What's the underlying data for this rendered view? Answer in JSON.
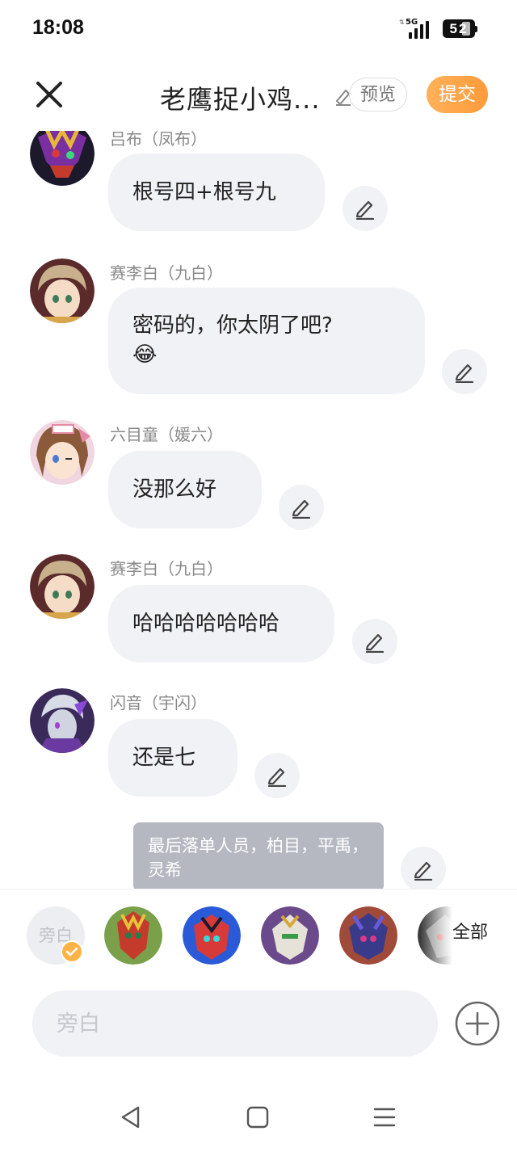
{
  "status_bar": {
    "time": "18:08",
    "network": "5G",
    "battery": "52"
  },
  "header": {
    "title": "老鹰捉小鸡...",
    "preview_label": "预览",
    "submit_label": "提交"
  },
  "messages": [
    {
      "sender": "吕布（凤布）",
      "text": "根号四+根号九",
      "emoji": ""
    },
    {
      "sender": "赛李白（九白）",
      "text": "密码的，你太阴了吧?",
      "emoji": "😂"
    },
    {
      "sender": "六目童（媛六）",
      "text": "没那么好",
      "emoji": ""
    },
    {
      "sender": "赛李白（九白）",
      "text": "哈哈哈哈哈哈哈",
      "emoji": ""
    },
    {
      "sender": "闪音（宇闪）",
      "text": "还是七",
      "emoji": ""
    }
  ],
  "narration": {
    "text": "最后落单人员，柏目，平禹，灵希"
  },
  "character_bar": {
    "narrator_label": "旁白",
    "all_label": "全部"
  },
  "input": {
    "placeholder": "旁白"
  },
  "colors": {
    "accent": "#ff9f40",
    "bubble": "#f1f2f5",
    "narration": "#b5b8c1"
  }
}
